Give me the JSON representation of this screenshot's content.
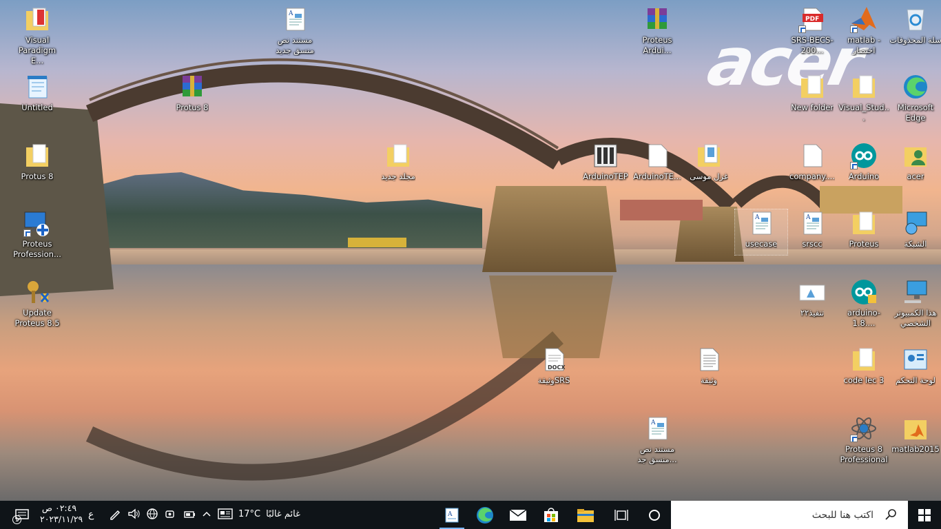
{
  "wallpaper": {
    "logo_text": "acer"
  },
  "icons": [
    {
      "id": "visual-paradigm",
      "label": "Visual Paradigm E...",
      "kind": "folder-doc"
    },
    {
      "id": "untitled",
      "label": "Untitled",
      "kind": "notepad"
    },
    {
      "id": "protus8-folder",
      "label": "Protus 8",
      "kind": "folder"
    },
    {
      "id": "proteus-prof",
      "label": "Proteus Profession...",
      "kind": "monitor"
    },
    {
      "id": "update-proteus",
      "label": "Update Proteus 8.5",
      "kind": "key"
    },
    {
      "id": "doc-new-1",
      "label": "مستند نص منسق جديد",
      "kind": "doc"
    },
    {
      "id": "protus8-rar",
      "label": "Protus 8",
      "kind": "rar"
    },
    {
      "id": "new-folder-ar",
      "label": "مجلد جديد",
      "kind": "folder"
    },
    {
      "id": "proteus-arduino-rar",
      "label": "Proteus Ardui...",
      "kind": "rar"
    },
    {
      "id": "arduinotep",
      "label": "ArduinoTEP",
      "kind": "library"
    },
    {
      "id": "arduinote-file",
      "label": "ArduinoTE...",
      "kind": "blank"
    },
    {
      "id": "ghazal-mousa",
      "label": "غزل موسى",
      "kind": "folder-doc"
    },
    {
      "id": "usecase",
      "label": "usecase",
      "kind": "doc"
    },
    {
      "id": "srscc",
      "label": "srscc",
      "kind": "doc"
    },
    {
      "id": "tanfeez",
      "label": "تنفيذ٢٢",
      "kind": "image"
    },
    {
      "id": "srs-docx",
      "label": "وثيقةSRS",
      "kind": "docx"
    },
    {
      "id": "wathiqa",
      "label": "وثيقة",
      "kind": "text"
    },
    {
      "id": "doc-new-2",
      "label": "مستند نص منسق جد...",
      "kind": "doc"
    },
    {
      "id": "srs-pdf",
      "label": "SRS-BECS-200...",
      "kind": "pdf"
    },
    {
      "id": "matlab-shortcut",
      "label": "matlab - اختصار",
      "kind": "matlab"
    },
    {
      "id": "recycle-bin",
      "label": "سلة المحذوفات",
      "kind": "recycle"
    },
    {
      "id": "new-folder",
      "label": "New folder",
      "kind": "folder"
    },
    {
      "id": "visual-stud",
      "label": "Visual_Stud...",
      "kind": "folder"
    },
    {
      "id": "edge",
      "label": "Microsoft Edge",
      "kind": "edge"
    },
    {
      "id": "company",
      "label": "company....",
      "kind": "blank"
    },
    {
      "id": "arduino",
      "label": "Arduino",
      "kind": "arduino"
    },
    {
      "id": "acer-user",
      "label": "acer",
      "kind": "user"
    },
    {
      "id": "proteus-folder",
      "label": "Proteus",
      "kind": "folder"
    },
    {
      "id": "network",
      "label": "الشبكة",
      "kind": "network"
    },
    {
      "id": "arduino-18",
      "label": "arduino-1.8....",
      "kind": "arduino"
    },
    {
      "id": "this-pc",
      "label": "هذا الكمبيوتر الشخصي",
      "kind": "pc"
    },
    {
      "id": "code-lec3",
      "label": "code lec 3",
      "kind": "folder"
    },
    {
      "id": "control-panel",
      "label": "لوحة التحكم",
      "kind": "control"
    },
    {
      "id": "proteus8-prof",
      "label": "Proteus 8 Professional",
      "kind": "atom"
    },
    {
      "id": "matlab2015",
      "label": "matlab2015",
      "kind": "folder-matlab"
    }
  ],
  "taskbar": {
    "search_placeholder": "اكتب هنا للبحث",
    "weather_text": "غائم غالبًا",
    "temperature": "17°C",
    "language": "ع",
    "time": "٠٢:٤٩ ص",
    "date": "٢٠٢٣/١١/٢٩",
    "notification_count": "1"
  }
}
